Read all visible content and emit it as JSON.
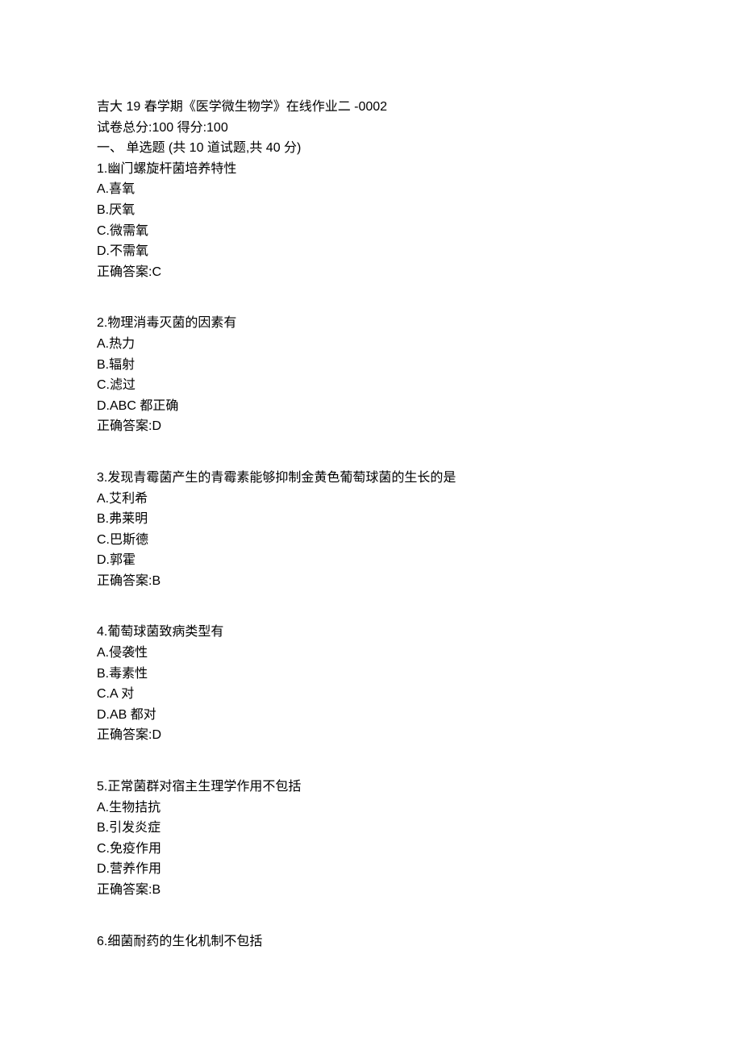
{
  "header": {
    "title": "吉大 19 春学期《医学微生物学》在线作业二  -0002",
    "scoreLine": "试卷总分:100      得分:100",
    "sectionTitle": "一、  单选题  (共  10  道试题,共  40  分)"
  },
  "questions": [
    {
      "stem": "1.幽门螺旋杆菌培养特性",
      "options": [
        "A.喜氧",
        "B.厌氧",
        "C.微需氧",
        "D.不需氧"
      ],
      "answer": "正确答案:C"
    },
    {
      "stem": "2.物理消毒灭菌的因素有",
      "options": [
        "A.热力",
        "B.辐射",
        "C.滤过",
        "D.ABC 都正确"
      ],
      "answer": "正确答案:D"
    },
    {
      "stem": "3.发现青霉菌产生的青霉素能够抑制金黄色葡萄球菌的生长的是",
      "options": [
        "A.艾利希",
        "B.弗莱明",
        "C.巴斯德",
        "D.郭霍"
      ],
      "answer": "正确答案:B"
    },
    {
      "stem": "4.葡萄球菌致病类型有",
      "options": [
        "A.侵袭性",
        "B.毒素性",
        "C.A 对",
        "D.AB 都对"
      ],
      "answer": "正确答案:D"
    },
    {
      "stem": "5.正常菌群对宿主生理学作用不包括",
      "options": [
        "A.生物拮抗",
        "B.引发炎症",
        "C.免疫作用",
        "D.营养作用"
      ],
      "answer": "正确答案:B"
    },
    {
      "stem": "6.细菌耐药的生化机制不包括",
      "options": [],
      "answer": ""
    }
  ]
}
